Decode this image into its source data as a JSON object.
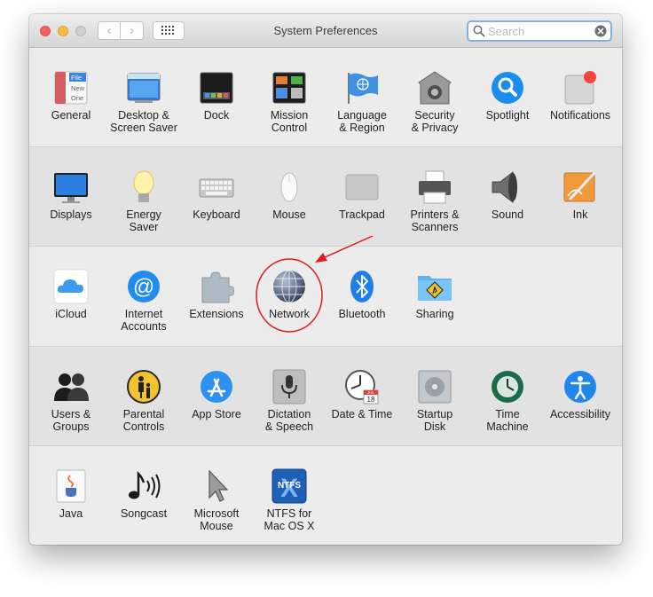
{
  "window": {
    "title": "System Preferences",
    "search_placeholder": "Search"
  },
  "toolbar": {
    "back_glyph": "‹",
    "forward_glyph": "›"
  },
  "rows": [
    [
      {
        "label": "General",
        "icon": "general-icon"
      },
      {
        "label": "Desktop &\nScreen Saver",
        "icon": "desktop-screen-saver-icon"
      },
      {
        "label": "Dock",
        "icon": "dock-icon"
      },
      {
        "label": "Mission\nControl",
        "icon": "mission-control-icon"
      },
      {
        "label": "Language\n& Region",
        "icon": "language-region-icon"
      },
      {
        "label": "Security\n& Privacy",
        "icon": "security-privacy-icon"
      },
      {
        "label": "Spotlight",
        "icon": "spotlight-icon"
      },
      {
        "label": "Notifications",
        "icon": "notifications-icon"
      }
    ],
    [
      {
        "label": "Displays",
        "icon": "displays-icon"
      },
      {
        "label": "Energy\nSaver",
        "icon": "energy-saver-icon"
      },
      {
        "label": "Keyboard",
        "icon": "keyboard-icon"
      },
      {
        "label": "Mouse",
        "icon": "mouse-icon"
      },
      {
        "label": "Trackpad",
        "icon": "trackpad-icon"
      },
      {
        "label": "Printers &\nScanners",
        "icon": "printers-scanners-icon"
      },
      {
        "label": "Sound",
        "icon": "sound-icon"
      },
      {
        "label": "Ink",
        "icon": "ink-icon"
      }
    ],
    [
      {
        "label": "iCloud",
        "icon": "icloud-icon"
      },
      {
        "label": "Internet\nAccounts",
        "icon": "internet-accounts-icon"
      },
      {
        "label": "Extensions",
        "icon": "extensions-icon"
      },
      {
        "label": "Network",
        "icon": "network-icon"
      },
      {
        "label": "Bluetooth",
        "icon": "bluetooth-icon"
      },
      {
        "label": "Sharing",
        "icon": "sharing-icon"
      }
    ],
    [
      {
        "label": "Users &\nGroups",
        "icon": "users-groups-icon"
      },
      {
        "label": "Parental\nControls",
        "icon": "parental-controls-icon"
      },
      {
        "label": "App Store",
        "icon": "app-store-icon"
      },
      {
        "label": "Dictation\n& Speech",
        "icon": "dictation-speech-icon"
      },
      {
        "label": "Date & Time",
        "icon": "date-time-icon"
      },
      {
        "label": "Startup\nDisk",
        "icon": "startup-disk-icon"
      },
      {
        "label": "Time\nMachine",
        "icon": "time-machine-icon"
      },
      {
        "label": "Accessibility",
        "icon": "accessibility-icon"
      }
    ],
    [
      {
        "label": "Java",
        "icon": "java-icon"
      },
      {
        "label": "Songcast",
        "icon": "songcast-icon"
      },
      {
        "label": "Microsoft\nMouse",
        "icon": "microsoft-mouse-icon"
      },
      {
        "label": "NTFS for\nMac OS X",
        "icon": "ntfs-icon"
      }
    ]
  ],
  "icon_text": {
    "general_file": "File",
    "general_new": "New",
    "general_one": "One",
    "calendar_month": "JUL",
    "calendar_day": "18",
    "ntfs": "NTFS",
    "ntfs_x": "X"
  },
  "annotation": {
    "target": "Network",
    "color": "#e01b1b"
  }
}
